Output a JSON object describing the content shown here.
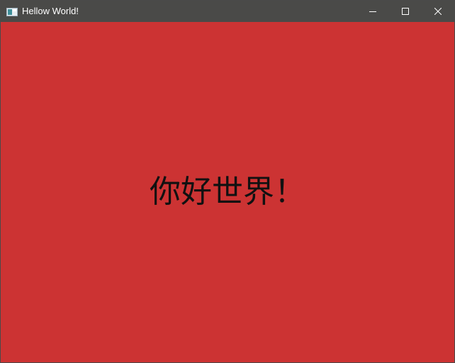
{
  "window": {
    "title": "Hellow World!",
    "app_icon": "window-app-icon",
    "background_color": "#cc3333",
    "titlebar_color": "#4a4a48"
  },
  "controls": {
    "minimize_icon": "minimize-icon",
    "maximize_icon": "maximize-icon",
    "close_icon": "close-icon"
  },
  "content": {
    "greeting": "你好世界！"
  }
}
